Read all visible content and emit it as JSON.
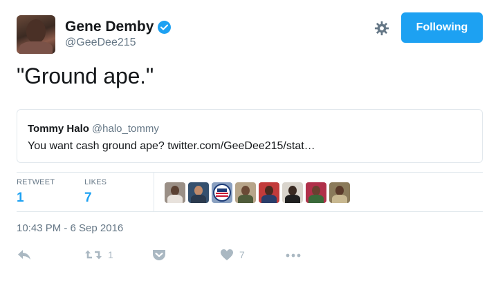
{
  "user": {
    "display_name": "Gene Demby",
    "handle": "@GeeDee215",
    "verified": true
  },
  "header": {
    "follow_label": "Following",
    "settings_icon": "gear-icon"
  },
  "tweet": {
    "text": "\"Ground ape.\"",
    "timestamp": "10:43 PM - 6 Sep 2016"
  },
  "quoted_tweet": {
    "name": "Tommy Halo",
    "handle": "@halo_tommy",
    "text": "You want cash ground ape? twitter.com/GeeDee215/stat…"
  },
  "stats": {
    "retweets_label": "RETWEET",
    "retweets_count": "1",
    "likes_label": "LIKES",
    "likes_count": "7"
  },
  "likers": [
    {
      "icon": "avatar",
      "bg": "#9a8f86",
      "head": "#5a4032",
      "body": "#e8e2dc"
    },
    {
      "icon": "avatar",
      "bg": "#35506e",
      "head": "#c08a6a",
      "body": "#2b3a4e"
    },
    {
      "icon": "usa-badge-avatar",
      "bg": "#8aa0c0",
      "head": "#c8102e",
      "body": "#ffffff"
    },
    {
      "icon": "avatar",
      "bg": "#b7a58a",
      "head": "#6b4a36",
      "body": "#4f5b3a"
    },
    {
      "icon": "avatar",
      "bg": "#c23b3b",
      "head": "#4b2a20",
      "body": "#2a3e6a"
    },
    {
      "icon": "avatar",
      "bg": "#d9d4cc",
      "head": "#3a2a22",
      "body": "#202020"
    },
    {
      "icon": "avatar",
      "bg": "#b0304a",
      "head": "#6a4030",
      "body": "#3a6a3a"
    },
    {
      "icon": "avatar",
      "bg": "#8a7a5a",
      "head": "#5a3a2a",
      "body": "#c8b890"
    }
  ],
  "actions": {
    "retweet_count": "1",
    "like_count": "7"
  },
  "colors": {
    "accent": "#1da1f2",
    "muted": "#657786",
    "icon": "#aab8c2",
    "border": "#e1e8ed"
  }
}
